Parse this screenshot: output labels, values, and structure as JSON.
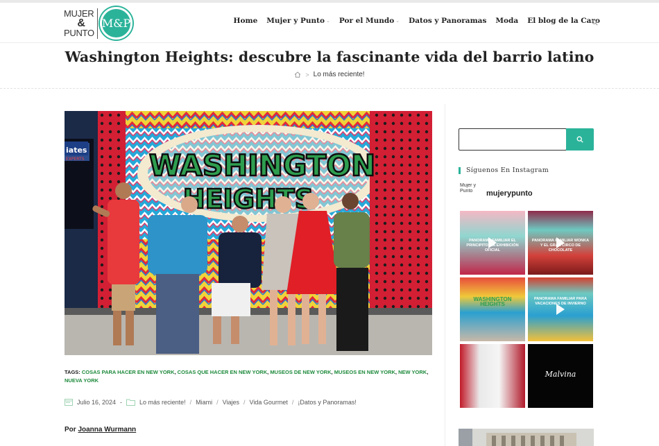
{
  "site": {
    "logo_line1": "MUJER",
    "logo_amp": "&",
    "logo_line2": "PUNTO",
    "logo_badge": "M&P"
  },
  "nav": {
    "items": [
      {
        "label": "Home",
        "has_dropdown": false
      },
      {
        "label": "Mujer y Punto",
        "has_dropdown": true
      },
      {
        "label": "Por el Mundo",
        "has_dropdown": true
      },
      {
        "label": "Datos y Panoramas",
        "has_dropdown": false
      },
      {
        "label": "Moda",
        "has_dropdown": false
      },
      {
        "label": "El blog de la Caro",
        "has_dropdown": false
      }
    ],
    "search_icon": "search-icon"
  },
  "page": {
    "title": "Washington Heights: descubre la fascinante vida del barrio latino",
    "breadcrumb": {
      "home_icon": "home-icon",
      "separator": ">",
      "current": "Lo más reciente!"
    }
  },
  "hero": {
    "mural_text_line1": "WASHINGTON",
    "mural_text_line2": "HEIGHTS",
    "sign_text": "iates",
    "sign_sub": "EXPERTS"
  },
  "tags": {
    "label": "TAGS:",
    "items": [
      "COSAS PARA HACER EN NEW YORK",
      "COSAS QUE HACER EN NEW YORK",
      "MUSEOS DE NEW YORK",
      "MUSEOS EN NEW YORK",
      "NEW YORK",
      "NUEVA YORK"
    ]
  },
  "meta": {
    "date": "Julio 16, 2024",
    "dash": "-",
    "categories": [
      "Lo más reciente!",
      "Miami",
      "Viajes",
      "Vida Gourmet",
      "¡Datos y Panoramas!"
    ],
    "separator": "/"
  },
  "byline": {
    "prefix": "Por",
    "author": "Joanna Wurmann"
  },
  "sidebar": {
    "search_placeholder": "",
    "instagram_title": "Síguenos En Instagram",
    "instagram_avatar_alt": "Mujer y Punto",
    "instagram_user": "mujerypunto",
    "tiles": [
      {
        "text": "PANORAMA FAMILIAR EL PRINCIPITO, LA EXHIBICIÓN OFICIAL",
        "video": true
      },
      {
        "text": "PANORAMA FAMILIAR WONKA Y EL GRAN CIRCO DE CHOCOLATE",
        "video": true
      },
      {
        "text": "WASHINGTON HEIGHTS",
        "video": false
      },
      {
        "text": "PANORAMA FAMILIAR PARA VACACIONES DE INVIERNO",
        "video": true
      },
      {
        "text": "",
        "video": false
      },
      {
        "text": "Malvina",
        "video": false
      }
    ]
  },
  "colors": {
    "accent": "#2bb39a",
    "tag_green": "#1e8a3c"
  }
}
